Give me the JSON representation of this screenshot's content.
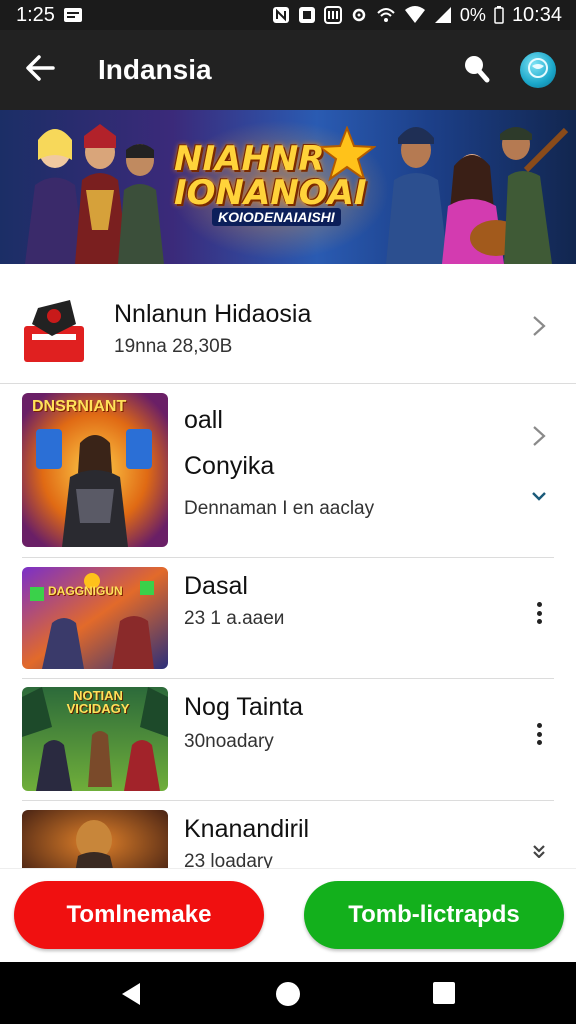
{
  "status_bar": {
    "time_left": "1:25",
    "battery": "0%",
    "time_right": "10:34"
  },
  "app_bar": {
    "title": "Indansia",
    "back_icon": "arrow-back-icon",
    "search_icon": "search-icon",
    "avatar_icon": "globe-avatar-icon"
  },
  "banner": {
    "title_line1": "NIAHNR",
    "title_line2": "IONANOAI",
    "subtitle": "KOIODENAIAISHI"
  },
  "list": {
    "items": [
      {
        "title": "Nnlanun Hidaosia",
        "subtitle": "19nna 28,30B",
        "trailing": "chevron-right-icon"
      },
      {
        "title": "oall",
        "title2": "Conyika",
        "subtitle": "Dennaman I en aaclay",
        "thumb_caption": "DNSRNIANT",
        "trailing": "chevron-right-icon",
        "trailing2": "chevron-down-icon"
      },
      {
        "title": "Dasal",
        "subtitle": "23 1 a.ааеи",
        "thumb_caption": "DAGGNIGUN",
        "trailing": "more-vert-icon"
      },
      {
        "title": "Nog Tainta",
        "subtitle": "30noadary",
        "thumb_caption": "NOTIAN VICIDAGY",
        "trailing": "more-vert-icon"
      },
      {
        "title": "Knanandiril",
        "subtitle": "23 loadary",
        "trailing": "chevron-down-icon"
      }
    ]
  },
  "actions": {
    "red_button": "Tomlnemake",
    "green_button": "Tomb-lictrapds",
    "colors": {
      "red": "#f01010",
      "green": "#13b01c"
    }
  },
  "nav": {
    "back_icon": "triangle-back-icon",
    "home_icon": "circle-home-icon",
    "recents_icon": "square-recents-icon"
  }
}
